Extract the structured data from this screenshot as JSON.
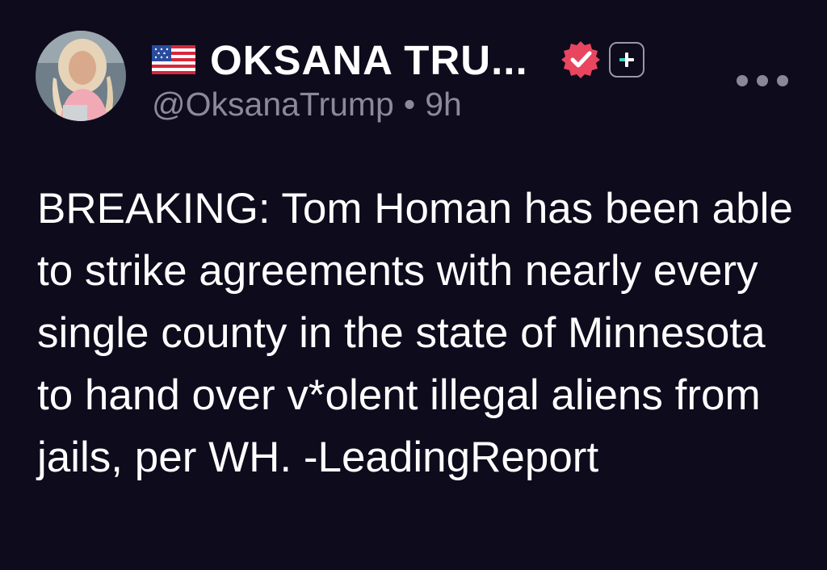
{
  "post": {
    "author": {
      "flag_icon": "us-flag-icon",
      "display_name": "OKSANA TRU...",
      "handle": "@OksanaTrump",
      "verified_icon": "verified-badge-icon",
      "follow_icon": "plus-icon"
    },
    "separator": "•",
    "timestamp": "9h",
    "more_icon": "more-options-icon",
    "text": "BREAKING: Tom Homan has been able to strike agreements with nearly every single county in the state of Minnesota to hand over v*olent illegal aliens from jails, per WH. -LeadingReport"
  },
  "colors": {
    "background": "#0d0b1c",
    "text": "#ffffff",
    "secondary_text": "#8c8a98",
    "verified_badge": "#e8455f"
  }
}
